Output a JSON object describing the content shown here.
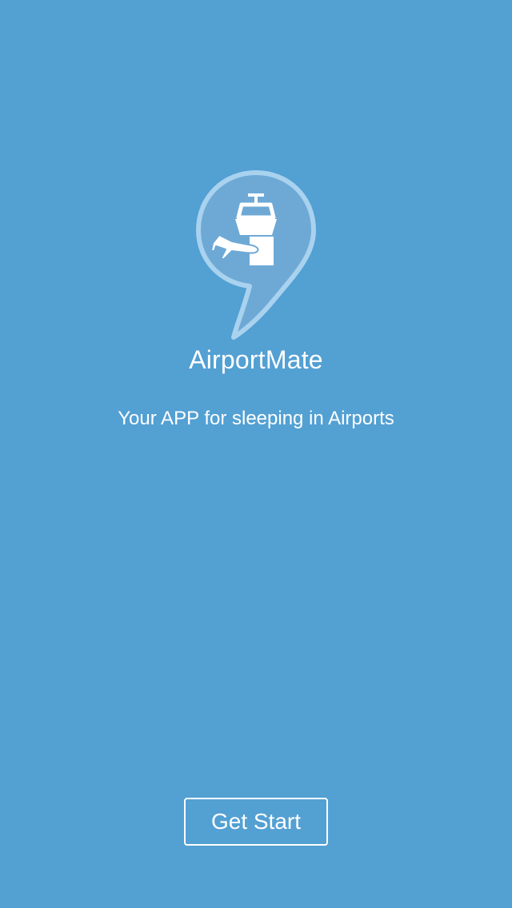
{
  "splash": {
    "app_name": "AirportMate",
    "tagline": "Your APP for sleeping in Airports",
    "get_start_label": "Get Start"
  },
  "logo": {
    "icon": "airport-tower-plane-pin-icon"
  },
  "colors": {
    "background": "#53a0d3",
    "text": "#ffffff",
    "logo_fill": "#6ea9d6",
    "logo_outline": "#a9d2ef"
  }
}
